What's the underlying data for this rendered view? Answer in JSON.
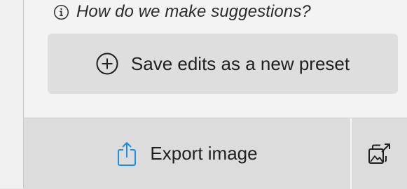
{
  "suggestions": {
    "link_text": "How do we make suggestions?",
    "icon": "info-icon"
  },
  "preset": {
    "button_label": "Save edits as a new preset",
    "icon": "plus-circle-icon"
  },
  "footer": {
    "export_label": "Export image",
    "export_icon": "share-icon",
    "export_icon_color": "#1e8fe0",
    "secondary_icon": "images-export-icon"
  }
}
